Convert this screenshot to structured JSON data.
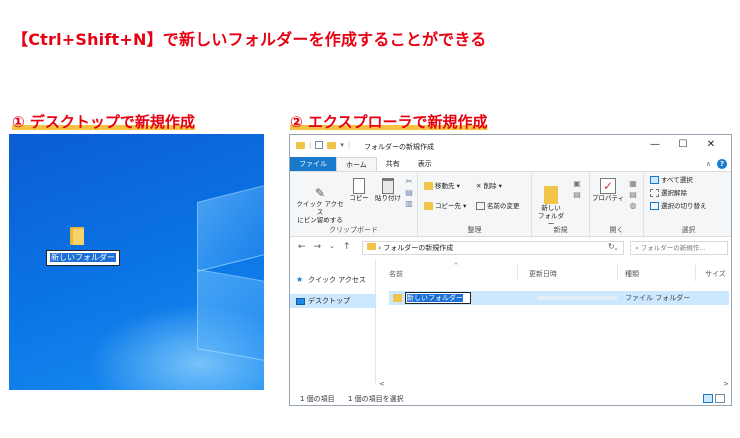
{
  "headline": "【Ctrl+Shift+N】で新しいフォルダーを作成することができる",
  "section1_title": "① デスクトップで新規作成",
  "section2_title": "② エクスプローラで新規作成",
  "desktop": {
    "rename_value": "新しいフォルダー"
  },
  "explorer": {
    "title": "フォルダーの新規作成",
    "qat_caret": "▾",
    "window_buttons": {
      "minimize": "—",
      "maximize": "☐",
      "close": "✕"
    },
    "tabs": [
      "ファイル",
      "ホーム",
      "共有",
      "表示"
    ],
    "ribbon_collapse": "∧",
    "help": "?",
    "ribbon": {
      "clipboard": {
        "pin": "クイック アクセス\nにピン留めする",
        "copy": "コピー",
        "paste": "貼り付け",
        "label": "クリップボード"
      },
      "organize": {
        "move": "移動先 ▾",
        "copyto": "コピー先 ▾",
        "delete": "✕ 削除 ▾",
        "rename": "名前の変更",
        "label": "整理"
      },
      "new": {
        "folder": "新しい\nフォルダー",
        "label": "新規"
      },
      "open": {
        "properties": "プロパティ",
        "label": "開く"
      },
      "select": {
        "all": "すべて選択",
        "none": "選択解除",
        "invert": "選択の切り替え",
        "label": "選択"
      }
    },
    "address": {
      "back": "←",
      "forward": "→",
      "down": "⌄",
      "up": "↑",
      "path": "›  フォルダーの新規作成",
      "path_caret": "⌄",
      "refresh": "↻",
      "search_placeholder": "⌕  フォルダーの新規作..."
    },
    "nav": {
      "quick_access": "クイック アクセス",
      "desktop": "デスクトップ"
    },
    "columns": {
      "name": "名前",
      "date": "更新日時",
      "type": "種類",
      "size": "サイズ",
      "sort_caret": "^"
    },
    "file": {
      "rename_value": "新しいフォルダー",
      "type": "ファイル フォルダー"
    },
    "scroll": {
      "left": "<",
      "right": ">"
    },
    "status": {
      "count": "1 個の項目",
      "selected": "1 個の項目を選択"
    }
  },
  "colors": {
    "accent_red": "#e60012",
    "highlight_yellow": "#f5c242",
    "file_tab": "#1979ca",
    "selection": "#cce8ff"
  }
}
